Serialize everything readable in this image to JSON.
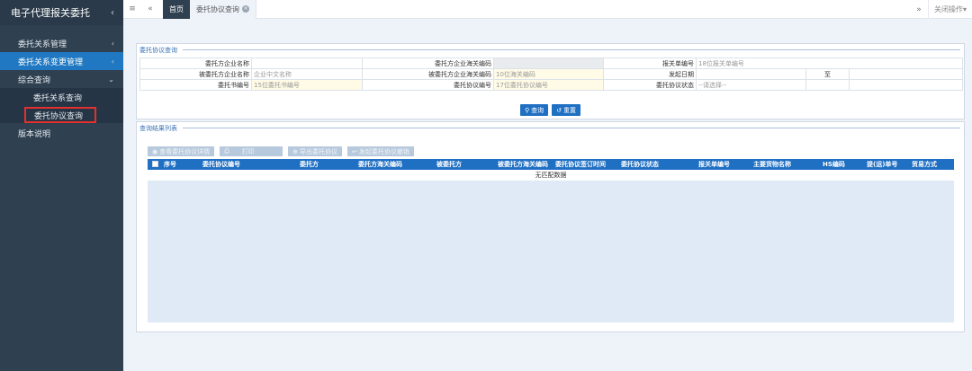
{
  "app": {
    "title": "电子代理报关委托"
  },
  "sidebar": {
    "items": [
      {
        "label": "委托关系管理",
        "active": false
      },
      {
        "label": "委托关系变更管理",
        "active": true
      },
      {
        "label": "综合查询",
        "expanded": true
      }
    ],
    "sub_items": [
      {
        "label": "委托关系查询"
      },
      {
        "label": "委托协议查询"
      }
    ],
    "last_item": {
      "label": "版本说明"
    }
  },
  "tabs": {
    "home": "首页",
    "current": "委托协议查询",
    "close_ops": "关闭操作"
  },
  "query": {
    "title": "委托协议查询",
    "fields": {
      "consignor_name_label": "委托方企业名称",
      "consignor_name_value": "",
      "consignor_code_label": "委托方企业海关编码",
      "consignor_code_value": "",
      "decl_no_label": "报关单编号",
      "decl_no_placeholder": "18位报关单编号",
      "consignee_name_label": "被委托方企业名称",
      "consignee_name_placeholder": "企业中文名称",
      "consignee_code_label": "被委托方企业海关编码",
      "consignee_code_placeholder": "10位海关编码",
      "start_date_label": "发起日期",
      "date_to_label": "至",
      "letter_no_label": "委托书编号",
      "letter_no_placeholder": "15位委托书编号",
      "agreement_no_label": "委托协议编号",
      "agreement_no_placeholder": "17位委托协议编号",
      "status_label": "委托协议状态",
      "status_placeholder": "--请选择--"
    },
    "buttons": {
      "search": "查询",
      "reset": "重置"
    }
  },
  "results": {
    "title": "查询结果列表",
    "toolbar": [
      "查看委托协议详情",
      "打印",
      "导出委托协议",
      "发起委托协议撤销"
    ],
    "columns": [
      "序号",
      "委托协议编号",
      "委托方",
      "委托方海关编码",
      "被委托方",
      "被委托方海关编码",
      "委托协议签订时间",
      "委托协议状态",
      "报关单编号",
      "主要货物名称",
      "HS编码",
      "提(运)单号",
      "贸易方式"
    ],
    "empty_text": "无匹配数据"
  },
  "colors": {
    "sidebar": "#2f4050",
    "accent": "#1f6fc3",
    "highlight": "#e2302f"
  }
}
